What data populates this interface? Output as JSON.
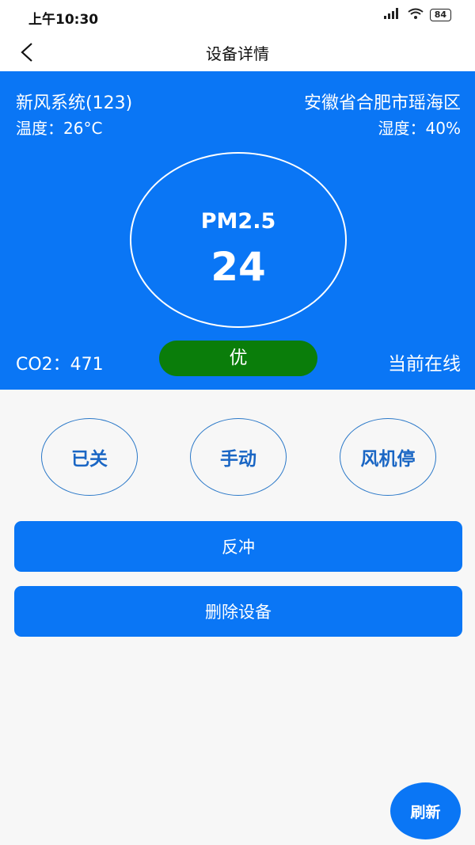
{
  "status_bar": {
    "time": "上午10:30",
    "battery": "84"
  },
  "nav": {
    "title": "设备详情"
  },
  "device": {
    "name": "新风系统(123)",
    "location": "安徽省合肥市瑶海区",
    "temperature": "温度：26°C",
    "humidity": "湿度：40%",
    "pm_label": "PM2.5",
    "pm_value": "24",
    "co2": "CO2：471",
    "quality": "优",
    "online_status": "当前在线"
  },
  "controls": {
    "power": "已关",
    "mode": "手动",
    "fan": "风机停"
  },
  "actions": {
    "backflush": "反冲",
    "delete_device": "删除设备"
  },
  "refresh": {
    "label": "刷新"
  },
  "colors": {
    "primary": "#0a76f5",
    "quality_good": "#0a7d0a",
    "control_text": "#1a66c4",
    "background": "#f7f7f7"
  }
}
